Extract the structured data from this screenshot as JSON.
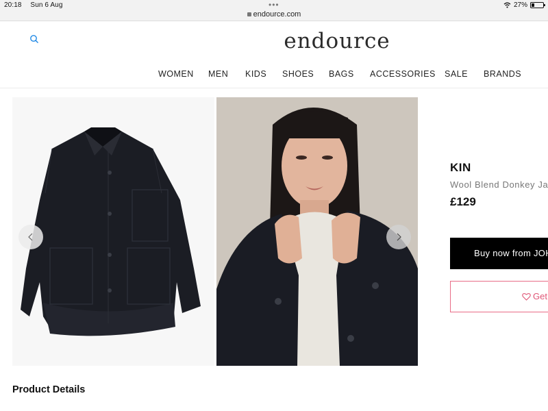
{
  "status_bar": {
    "time": "20:18",
    "date": "Sun 6 Aug",
    "url": "endource.com",
    "battery_percent": "27%",
    "battery_level": 0.27
  },
  "header": {
    "logo": "endource",
    "search_icon": "search-icon",
    "nav": [
      "WOMEN",
      "MEN",
      "KIDS",
      "SHOES",
      "BAGS",
      "ACCESSORIES",
      "SALE",
      "BRANDS"
    ]
  },
  "gallery": {
    "prev_icon": "chevron-left-icon",
    "next_icon": "chevron-right-icon"
  },
  "product": {
    "brand": "KIN",
    "name": "Wool Blend Donkey Ja",
    "price": "£129",
    "buy_label": "Buy now from JOH",
    "wishlist_label": "Get",
    "wishlist_icon": "heart-icon"
  },
  "details": {
    "heading": "Product Details"
  },
  "colors": {
    "accent_pink": "#e05576",
    "button_black": "#000000"
  }
}
